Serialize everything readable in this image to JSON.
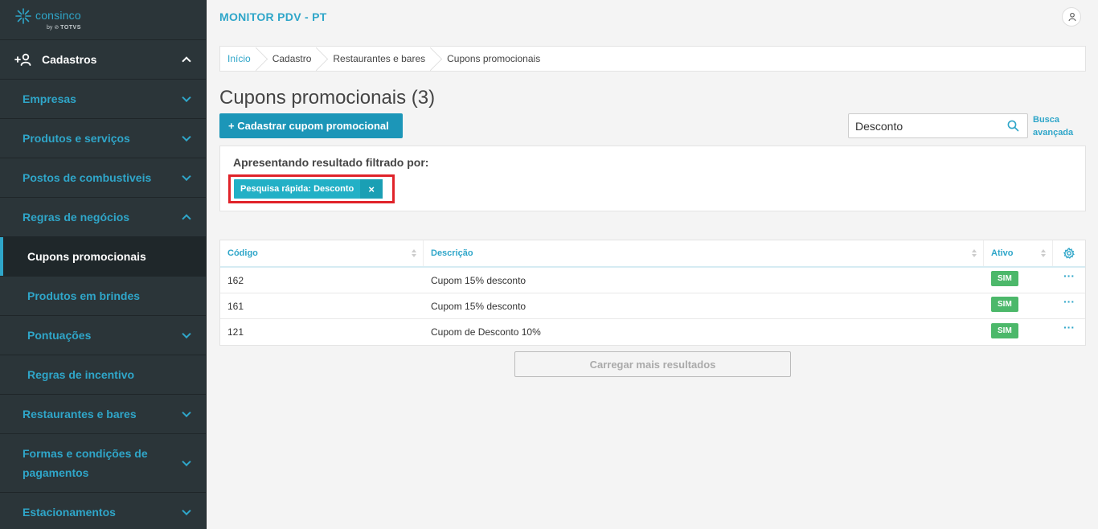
{
  "brand": {
    "name": "consinco",
    "by": "by",
    "parent": "TOTVS"
  },
  "sidebar": {
    "section": "Cadastros",
    "items": [
      {
        "label": "Empresas",
        "chevron": "down",
        "level": "top"
      },
      {
        "label": "Produtos e serviços",
        "chevron": "down",
        "level": "top"
      },
      {
        "label": "Postos de combustiveis",
        "chevron": "down",
        "level": "top"
      },
      {
        "label": "Regras de negócios",
        "chevron": "up",
        "level": "top"
      },
      {
        "label": "Cupons promocionais",
        "chevron": "none",
        "level": "sub",
        "active": true
      },
      {
        "label": "Produtos em brindes",
        "chevron": "none",
        "level": "sub"
      },
      {
        "label": "Pontuações",
        "chevron": "down",
        "level": "sub"
      },
      {
        "label": "Regras de incentivo",
        "chevron": "none",
        "level": "sub"
      },
      {
        "label": "Restaurantes e bares",
        "chevron": "down",
        "level": "top"
      },
      {
        "label": "Formas e condições de pagamentos",
        "chevron": "down",
        "level": "top"
      },
      {
        "label": "Estacionamentos",
        "chevron": "down",
        "level": "top"
      }
    ]
  },
  "header": {
    "app_title": "MONITOR PDV - PT"
  },
  "breadcrumb": [
    "Início",
    "Cadastro",
    "Restaurantes e bares",
    "Cupons promocionais"
  ],
  "page": {
    "title": "Cupons promocionais (3)",
    "add_button": "+ Cadastrar cupom promocional",
    "search_value": "Desconto",
    "advanced_search_line1": "Busca",
    "advanced_search_line2": "avançada"
  },
  "filter": {
    "label": "Apresentando resultado filtrado por:",
    "chip": "Pesquisa rápida: Desconto",
    "chip_close": "×"
  },
  "table": {
    "columns": [
      "Código",
      "Descrição",
      "Ativo"
    ],
    "rows": [
      {
        "code": "162",
        "description": "Cupom 15% desconto",
        "active": "SIM"
      },
      {
        "code": "161",
        "description": "Cupom 15% desconto",
        "active": "SIM"
      },
      {
        "code": "121",
        "description": "Cupom de Desconto 10%",
        "active": "SIM"
      }
    ],
    "row_actions": "···",
    "load_more": "Carregar mais resultados"
  },
  "colors": {
    "accent": "#2fa6c9",
    "sidebar_bg": "#2b3539",
    "primary_button": "#1c96b8",
    "chip": "#22b0c6",
    "highlight_border": "#e0232a",
    "badge_green": "#4cb86a"
  }
}
